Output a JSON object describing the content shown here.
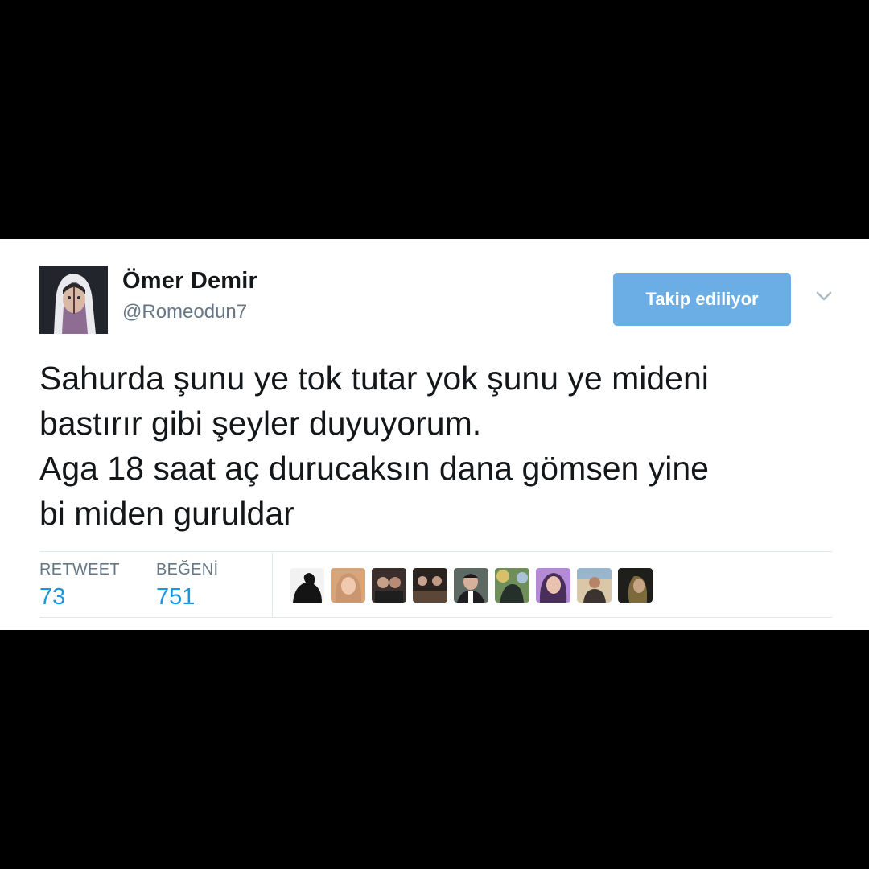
{
  "tweet": {
    "display_name": "Ömer Demir",
    "handle": "@Romeodun7",
    "follow_button_label": "Takip ediliyor",
    "text_lines": [
      "Sahurda şunu ye tok tutar yok şunu ye mideni",
      "bastırır gibi şeyler duyuyorum.",
      "Aga 18 saat aç durucaksın dana gömsen yine",
      "bi miden guruldar"
    ],
    "stats": {
      "retweet_label": "RETWEET",
      "retweet_count": "73",
      "like_label": "BEĞENİ",
      "like_count": "751"
    },
    "liker_avatars": [
      "liker-avatar-1",
      "liker-avatar-2",
      "liker-avatar-3",
      "liker-avatar-4",
      "liker-avatar-5",
      "liker-avatar-6",
      "liker-avatar-7",
      "liker-avatar-8",
      "liker-avatar-9"
    ]
  },
  "colors": {
    "follow_button_bg": "#6aaee5",
    "stat_value": "#1b95e0",
    "secondary_text": "#657786",
    "primary_text": "#14171a",
    "letterbox": "#000000"
  },
  "icons": {
    "menu_caret": "chevron-down-icon"
  }
}
